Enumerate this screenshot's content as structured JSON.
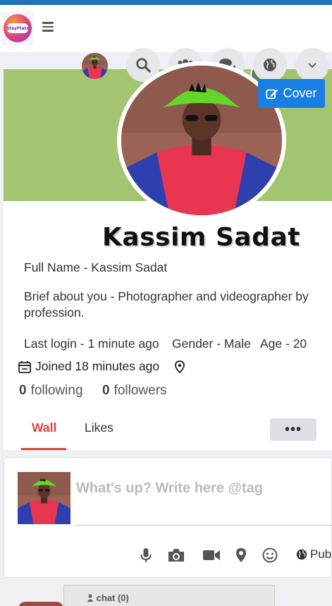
{
  "header": {
    "logo_text": "StayPlatz"
  },
  "nav": {
    "icons": [
      "search-icon",
      "users-icon",
      "comments-icon",
      "globe-icon",
      "chevron-down-icon"
    ]
  },
  "profile": {
    "cover_button_label": "Cover",
    "name": "Kassim Sadat",
    "full_name": "Full Name - Kassim Sadat",
    "brief": "Brief about you - Photographer and videographer by profession.",
    "last_login": "Last login - 1 minute ago",
    "gender": "Gender - Male",
    "age": "Age - 20",
    "joined": "Joined 18 minutes ago",
    "following_count": "0",
    "following_label": "following",
    "followers_count": "0",
    "followers_label": "followers"
  },
  "tabs": [
    {
      "label": "Wall",
      "active": true
    },
    {
      "label": "Likes",
      "active": false
    }
  ],
  "more_button_label": "•••",
  "composer": {
    "placeholder": "What's up? Write here @tag",
    "privacy_label": "Public"
  },
  "chat": {
    "label": "chat (0)"
  },
  "colors": {
    "cover": "#a3c572",
    "primary": "#1a7fe3",
    "active_tab": "#d9453a",
    "top_strip": "#1d73b8"
  }
}
